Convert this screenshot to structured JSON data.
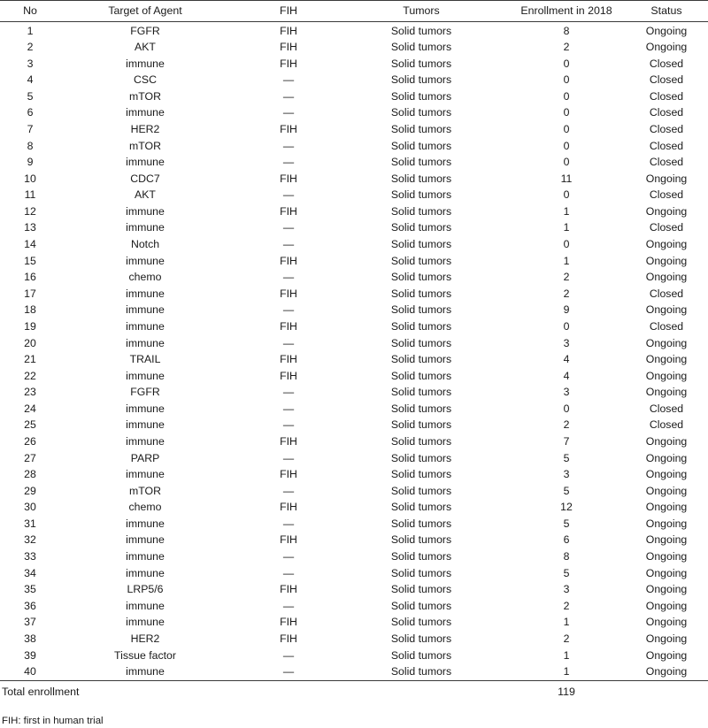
{
  "table": {
    "columns": [
      {
        "key": "no",
        "label": "No"
      },
      {
        "key": "target",
        "label": "Target of Agent"
      },
      {
        "key": "fih",
        "label": "FIH"
      },
      {
        "key": "tumors",
        "label": "Tumors"
      },
      {
        "key": "enroll",
        "label": "Enrollment in 2018"
      },
      {
        "key": "status",
        "label": "Status"
      }
    ],
    "rows": [
      {
        "no": "1",
        "target": "FGFR",
        "fih": "FIH",
        "tumors": "Solid tumors",
        "enroll": "8",
        "status": "Ongoing"
      },
      {
        "no": "2",
        "target": "AKT",
        "fih": "FIH",
        "tumors": "Solid tumors",
        "enroll": "2",
        "status": "Ongoing"
      },
      {
        "no": "3",
        "target": "immune",
        "fih": "FIH",
        "tumors": "Solid tumors",
        "enroll": "0",
        "status": "Closed"
      },
      {
        "no": "4",
        "target": "CSC",
        "fih": "—",
        "tumors": "Solid tumors",
        "enroll": "0",
        "status": "Closed"
      },
      {
        "no": "5",
        "target": "mTOR",
        "fih": "—",
        "tumors": "Solid tumors",
        "enroll": "0",
        "status": "Closed"
      },
      {
        "no": "6",
        "target": "immune",
        "fih": "—",
        "tumors": "Solid tumors",
        "enroll": "0",
        "status": "Closed"
      },
      {
        "no": "7",
        "target": "HER2",
        "fih": "FIH",
        "tumors": "Solid tumors",
        "enroll": "0",
        "status": "Closed"
      },
      {
        "no": "8",
        "target": "mTOR",
        "fih": "—",
        "tumors": "Solid tumors",
        "enroll": "0",
        "status": "Closed"
      },
      {
        "no": "9",
        "target": "immune",
        "fih": "—",
        "tumors": "Solid tumors",
        "enroll": "0",
        "status": "Closed"
      },
      {
        "no": "10",
        "target": "CDC7",
        "fih": "FIH",
        "tumors": "Solid tumors",
        "enroll": "11",
        "status": "Ongoing"
      },
      {
        "no": "11",
        "target": "AKT",
        "fih": "—",
        "tumors": "Solid tumors",
        "enroll": "0",
        "status": "Closed"
      },
      {
        "no": "12",
        "target": "immune",
        "fih": "FIH",
        "tumors": "Solid tumors",
        "enroll": "1",
        "status": "Ongoing"
      },
      {
        "no": "13",
        "target": "immune",
        "fih": "—",
        "tumors": "Solid tumors",
        "enroll": "1",
        "status": "Closed"
      },
      {
        "no": "14",
        "target": "Notch",
        "fih": "—",
        "tumors": "Solid tumors",
        "enroll": "0",
        "status": "Ongoing"
      },
      {
        "no": "15",
        "target": "immune",
        "fih": "FIH",
        "tumors": "Solid tumors",
        "enroll": "1",
        "status": "Ongoing"
      },
      {
        "no": "16",
        "target": "chemo",
        "fih": "—",
        "tumors": "Solid tumors",
        "enroll": "2",
        "status": "Ongoing"
      },
      {
        "no": "17",
        "target": "immune",
        "fih": "FIH",
        "tumors": "Solid tumors",
        "enroll": "2",
        "status": "Closed"
      },
      {
        "no": "18",
        "target": "immune",
        "fih": "—",
        "tumors": "Solid tumors",
        "enroll": "9",
        "status": "Ongoing"
      },
      {
        "no": "19",
        "target": "immune",
        "fih": "FIH",
        "tumors": "Solid tumors",
        "enroll": "0",
        "status": "Closed"
      },
      {
        "no": "20",
        "target": "immune",
        "fih": "—",
        "tumors": "Solid tumors",
        "enroll": "3",
        "status": "Ongoing"
      },
      {
        "no": "21",
        "target": "TRAIL",
        "fih": "FIH",
        "tumors": "Solid tumors",
        "enroll": "4",
        "status": "Ongoing"
      },
      {
        "no": "22",
        "target": "immune",
        "fih": "FIH",
        "tumors": "Solid tumors",
        "enroll": "4",
        "status": "Ongoing"
      },
      {
        "no": "23",
        "target": "FGFR",
        "fih": "—",
        "tumors": "Solid tumors",
        "enroll": "3",
        "status": "Ongoing"
      },
      {
        "no": "24",
        "target": "immune",
        "fih": "—",
        "tumors": "Solid tumors",
        "enroll": "0",
        "status": "Closed"
      },
      {
        "no": "25",
        "target": "immune",
        "fih": "—",
        "tumors": "Solid tumors",
        "enroll": "2",
        "status": "Closed"
      },
      {
        "no": "26",
        "target": "immune",
        "fih": "FIH",
        "tumors": "Solid tumors",
        "enroll": "7",
        "status": "Ongoing"
      },
      {
        "no": "27",
        "target": "PARP",
        "fih": "—",
        "tumors": "Solid tumors",
        "enroll": "5",
        "status": "Ongoing"
      },
      {
        "no": "28",
        "target": "immune",
        "fih": "FIH",
        "tumors": "Solid tumors",
        "enroll": "3",
        "status": "Ongoing"
      },
      {
        "no": "29",
        "target": "mTOR",
        "fih": "—",
        "tumors": "Solid tumors",
        "enroll": "5",
        "status": "Ongoing"
      },
      {
        "no": "30",
        "target": "chemo",
        "fih": "FIH",
        "tumors": "Solid tumors",
        "enroll": "12",
        "status": "Ongoing"
      },
      {
        "no": "31",
        "target": "immune",
        "fih": "—",
        "tumors": "Solid tumors",
        "enroll": "5",
        "status": "Ongoing"
      },
      {
        "no": "32",
        "target": "immune",
        "fih": "FIH",
        "tumors": "Solid tumors",
        "enroll": "6",
        "status": "Ongoing"
      },
      {
        "no": "33",
        "target": "immune",
        "fih": "—",
        "tumors": "Solid tumors",
        "enroll": "8",
        "status": "Ongoing"
      },
      {
        "no": "34",
        "target": "immune",
        "fih": "—",
        "tumors": "Solid tumors",
        "enroll": "5",
        "status": "Ongoing"
      },
      {
        "no": "35",
        "target": "LRP5/6",
        "fih": "FIH",
        "tumors": "Solid tumors",
        "enroll": "3",
        "status": "Ongoing"
      },
      {
        "no": "36",
        "target": "immune",
        "fih": "—",
        "tumors": "Solid tumors",
        "enroll": "2",
        "status": "Ongoing"
      },
      {
        "no": "37",
        "target": "immune",
        "fih": "FIH",
        "tumors": "Solid tumors",
        "enroll": "1",
        "status": "Ongoing"
      },
      {
        "no": "38",
        "target": "HER2",
        "fih": "FIH",
        "tumors": "Solid tumors",
        "enroll": "2",
        "status": "Ongoing"
      },
      {
        "no": "39",
        "target": "Tissue factor",
        "fih": "—",
        "tumors": "Solid tumors",
        "enroll": "1",
        "status": "Ongoing"
      },
      {
        "no": "40",
        "target": "immune",
        "fih": "—",
        "tumors": "Solid tumors",
        "enroll": "1",
        "status": "Ongoing"
      }
    ],
    "total": {
      "label": "Total enrollment",
      "value": "119"
    }
  },
  "footnote": "FIH: first in human trial"
}
